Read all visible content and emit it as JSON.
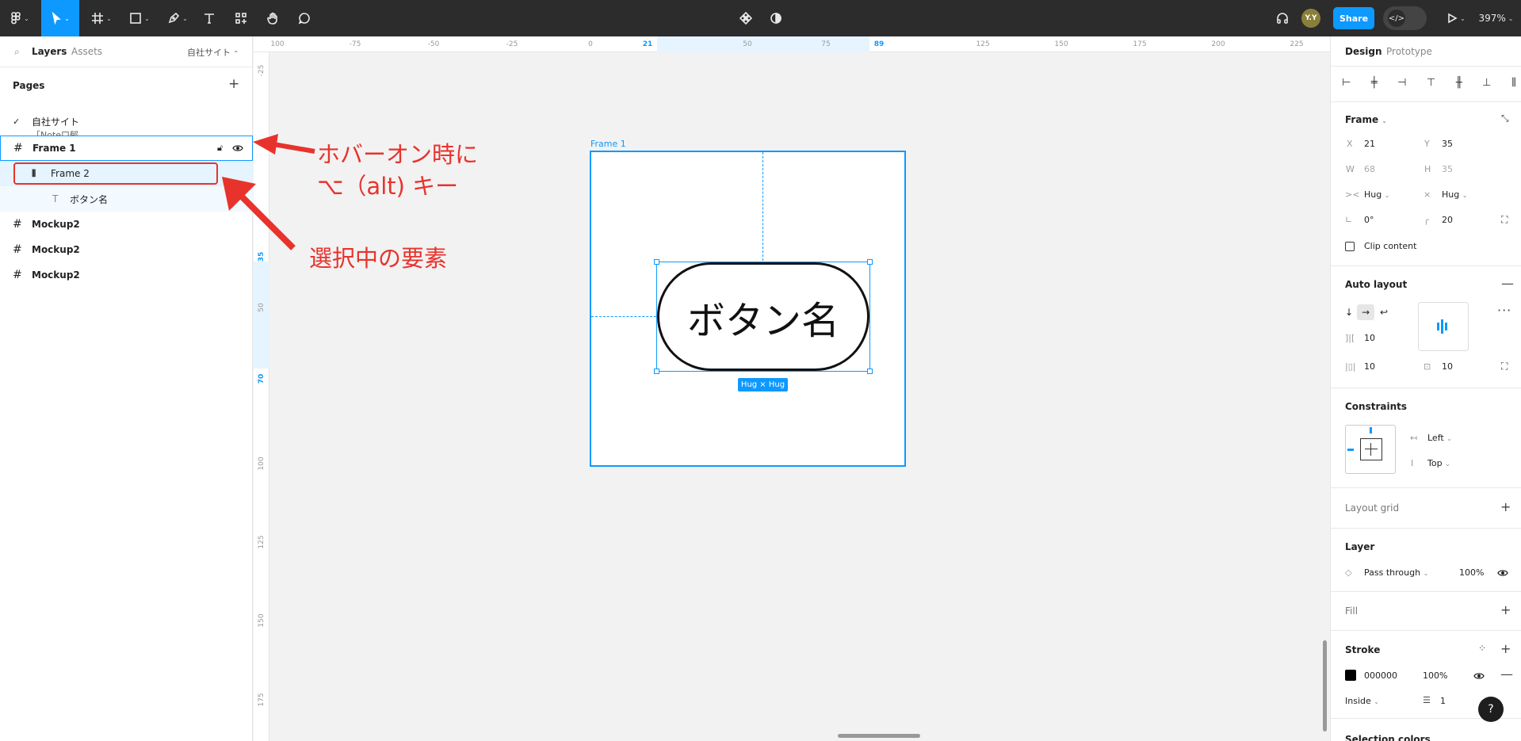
{
  "toolbar": {
    "zoom": "397%",
    "share_label": "Share",
    "avatar_initials": "Y.Y"
  },
  "left_panel": {
    "tabs": [
      "Layers",
      "Assets"
    ],
    "page_switcher": "自社サイト",
    "pages_title": "Pages",
    "pages": [
      "自社サイト",
      "「Note口郁"
    ],
    "layers": [
      {
        "name": "Frame 1"
      },
      {
        "name": "Frame 2"
      },
      {
        "name": "ボタン名"
      },
      {
        "name": "Mockup2"
      },
      {
        "name": "Mockup2"
      },
      {
        "name": "Mockup2"
      }
    ]
  },
  "annotations": {
    "hover_line1": "ホバーオン時に",
    "hover_line2": "⌥（alt) キー",
    "selected": "選択中の要素"
  },
  "ruler_top": [
    "100",
    "-75",
    "-50",
    "-25",
    "0",
    "21",
    "50",
    "75",
    "89",
    "125",
    "150",
    "175",
    "200",
    "225"
  ],
  "ruler_left": [
    "-25",
    "35",
    "50",
    "70",
    "100",
    "125",
    "150",
    "175"
  ],
  "canvas": {
    "frame_label": "Frame 1",
    "button_text": "ボタン名",
    "size_badge": "Hug × Hug"
  },
  "right_panel": {
    "tabs": [
      "Design",
      "Prototype"
    ],
    "frame_section": "Frame",
    "x_label": "X",
    "x": "21",
    "y_label": "Y",
    "y": "35",
    "w_label": "W",
    "w": "68",
    "h_label": "H",
    "h": "35",
    "hug_w": "Hug",
    "hug_h": "Hug",
    "rotation": "0°",
    "radius": "20",
    "clip_content": "Clip content",
    "auto_layout": "Auto layout",
    "gap": "10",
    "pad_h": "10",
    "pad_v": "10",
    "constraints": "Constraints",
    "constraint_h": "Left",
    "constraint_v": "Top",
    "layout_grid": "Layout grid",
    "layer": "Layer",
    "blend": "Pass through",
    "opacity": "100%",
    "fill": "Fill",
    "stroke": "Stroke",
    "stroke_color": "000000",
    "stroke_opacity": "100%",
    "stroke_position": "Inside",
    "stroke_weight": "1",
    "selection_colors": "Selection colors"
  },
  "colors": {
    "accent": "#0d99ff",
    "annotation": "#e8332d",
    "toolbar_bg": "#2c2c2c"
  }
}
